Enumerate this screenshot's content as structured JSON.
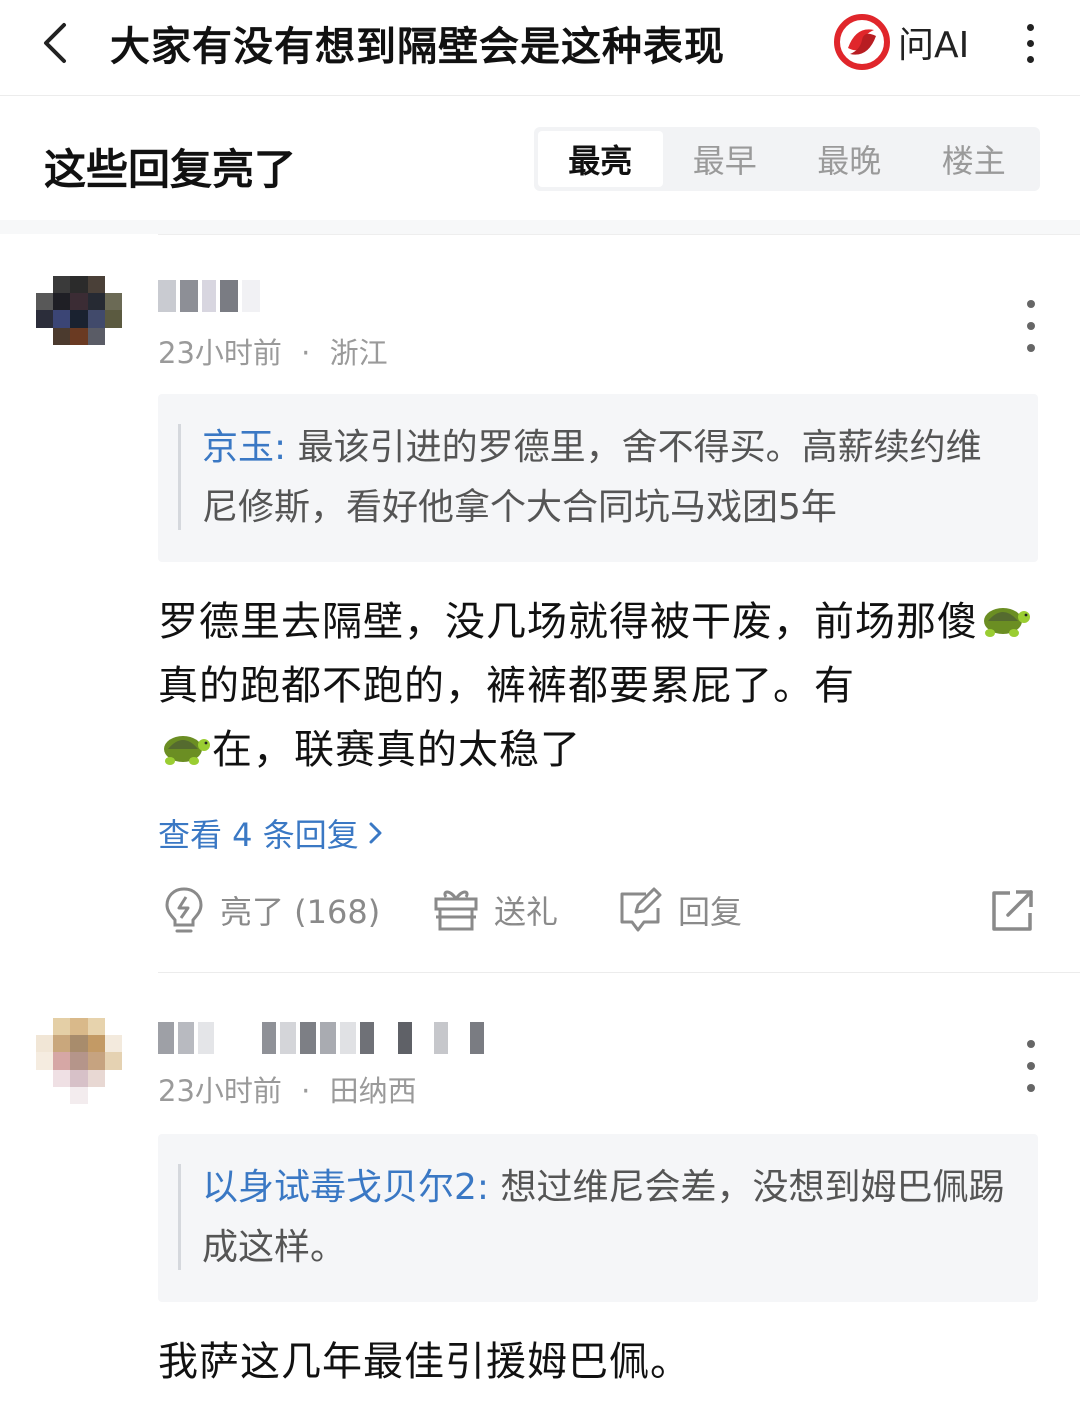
{
  "header": {
    "title": "大家有没有想到隔壁会是这种表现",
    "ask_ai_label": "问AI"
  },
  "section": {
    "title": "这些回复亮了",
    "tabs": [
      {
        "label": "最亮",
        "active": true
      },
      {
        "label": "最早",
        "active": false
      },
      {
        "label": "最晚",
        "active": false
      },
      {
        "label": "楼主",
        "active": false
      }
    ]
  },
  "comments": [
    {
      "time": "23小时前",
      "separator": "·",
      "location": "浙江",
      "quote_author": "京玉:",
      "quote_text": "最该引进的罗德里，舍不得买。高薪续约维尼修斯，看好他拿个大合同坑马戏团5年",
      "body_part1": "罗德里去隔壁，没几场就得被干废，前场那傻",
      "body_part2": "真的跑都不跑的，裤裤都要累屁了。有",
      "body_part3": "在，联赛真的太稳了",
      "view_replies": "查看 4 条回复",
      "like_label": "亮了 (168)",
      "gift_label": "送礼",
      "reply_label": "回复"
    },
    {
      "time": "23小时前",
      "separator": "·",
      "location": "田纳西",
      "quote_author": "以身试毒戈贝尔2:",
      "quote_text": "想过维尼会差，没想到姆巴佩踢成这样。",
      "body": "我萨这几年最佳引援姆巴佩。"
    }
  ],
  "icons": {
    "back": "back-arrow-icon",
    "more": "more-vertical-icon",
    "turtle": "turtle-emoji-icon",
    "like": "lightbulb-icon",
    "gift": "gift-icon",
    "reply": "edit-reply-icon",
    "share": "share-external-icon",
    "chevron": "chevron-right-icon"
  },
  "colors": {
    "link_blue": "#3a78c4",
    "ai_logo_red": "#e0262b",
    "muted_gray": "#9a9a9a"
  }
}
